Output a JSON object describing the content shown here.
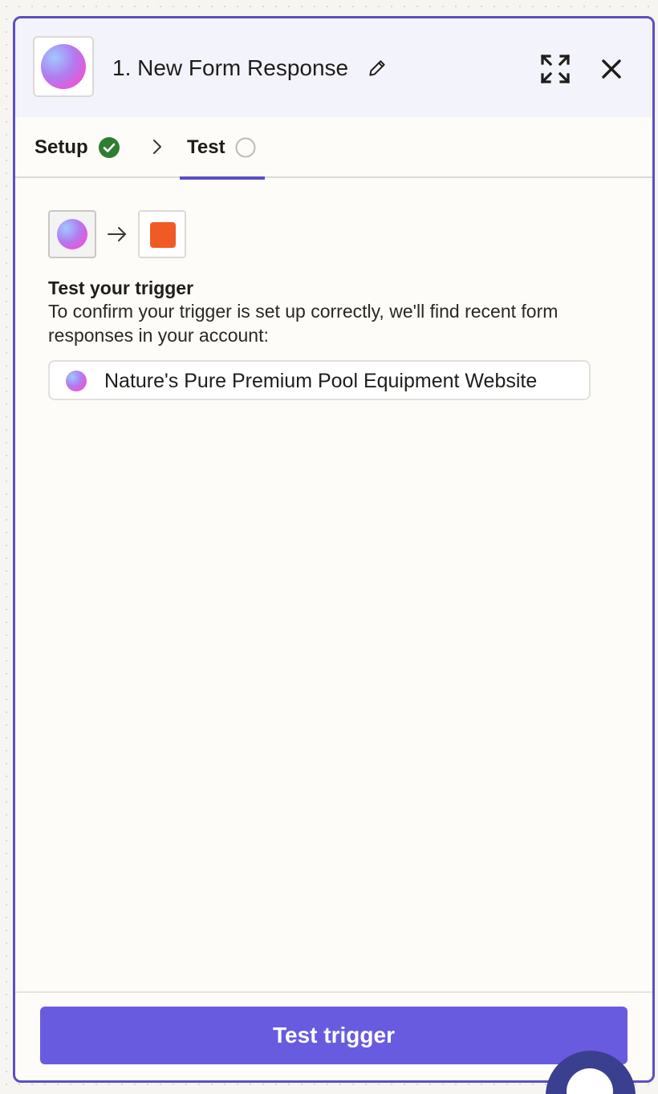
{
  "header": {
    "title": "1. New Form Response",
    "app_icon": "gradient-orb-icon",
    "edit_icon": "pencil-icon",
    "expand_icon": "expand-arrows-icon",
    "close_icon": "close-icon"
  },
  "tabs": {
    "setup": {
      "label": "Setup",
      "status": "complete",
      "status_icon": "check-circle-icon"
    },
    "separator_icon": "chevron-right-icon",
    "test": {
      "label": "Test",
      "status": "incomplete",
      "status_icon": "empty-circle-icon",
      "active": true
    }
  },
  "flow": {
    "source_icon": "gradient-orb-icon",
    "arrow_icon": "arrow-right-icon",
    "destination_icon": "orange-square-icon"
  },
  "content": {
    "heading": "Test your trigger",
    "description": "To confirm your trigger is set up correctly, we'll find recent form responses in your account:",
    "source": {
      "label": "Nature's Pure Premium Pool Equipment Website",
      "icon": "gradient-orb-icon"
    }
  },
  "footer": {
    "button_label": "Test trigger"
  },
  "colors": {
    "accent": "#5b4fc4",
    "button": "#695be0",
    "success": "#2e7d32",
    "destination": "#f05a24",
    "header_bg": "#f3f3fb"
  }
}
